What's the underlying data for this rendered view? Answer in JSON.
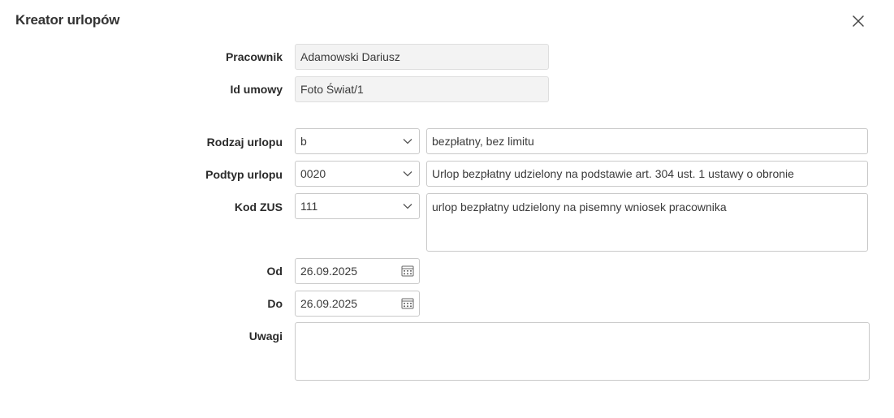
{
  "header": {
    "title": "Kreator urlopów"
  },
  "form": {
    "pracownik": {
      "label": "Pracownik",
      "value": "Adamowski Dariusz"
    },
    "id_umowy": {
      "label": "Id umowy",
      "value": "Foto Świat/1"
    },
    "rodzaj_urlopu": {
      "label": "Rodzaj urlopu",
      "code": "b",
      "description": "bezpłatny, bez limitu"
    },
    "podtyp_urlopu": {
      "label": "Podtyp urlopu",
      "code": "0020",
      "description": "Urlop bezpłatny udzielony na podstawie art. 304 ust. 1 ustawy o obronie"
    },
    "kod_zus": {
      "label": "Kod ZUS",
      "code": "111",
      "description": "urlop bezpłatny udzielony na pisemny wniosek pracownika"
    },
    "od": {
      "label": "Od",
      "value": "26.09.2025"
    },
    "do": {
      "label": "Do",
      "value": "26.09.2025"
    },
    "uwagi": {
      "label": "Uwagi",
      "value": ""
    }
  },
  "icons": {
    "close": "close-icon",
    "dropdown": "chevron-down-icon",
    "calendar": "calendar-icon"
  },
  "colors": {
    "border": "#c9c9c9",
    "readonly_bg": "#f3f3f3",
    "text": "#2b2b2b"
  }
}
